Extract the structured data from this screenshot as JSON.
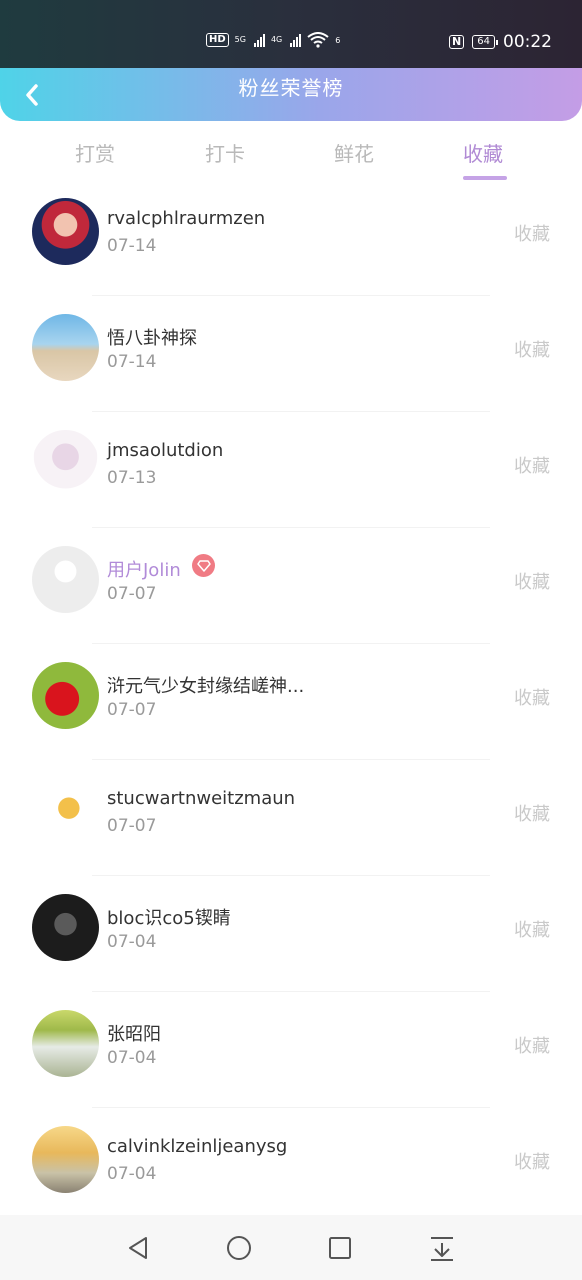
{
  "status": {
    "time": "00:22",
    "battery": "64",
    "hd_label": "HD",
    "net1": "5G",
    "net2": "4G",
    "wifi_label": "6"
  },
  "header": {
    "title": "粉丝荣誉榜"
  },
  "tabs": [
    {
      "label": "打赏",
      "active": false
    },
    {
      "label": "打卡",
      "active": false
    },
    {
      "label": "鲜花",
      "active": false
    },
    {
      "label": "收藏",
      "active": true
    }
  ],
  "rows": [
    {
      "name": "rvalcphlraurmzen",
      "date": "07-14",
      "action": "收藏"
    },
    {
      "name": "悟八卦神探",
      "date": "07-14",
      "action": "收藏"
    },
    {
      "name": "jmsaolutdion",
      "date": "07-13",
      "action": "收藏"
    },
    {
      "name": "用户Jolin",
      "date": "07-07",
      "action": "收藏",
      "vip": true
    },
    {
      "name": "浒元气少女封缘结嵯神...",
      "date": "07-07",
      "action": "收藏"
    },
    {
      "name": "stucwartnweitzmaun",
      "date": "07-07",
      "action": "收藏"
    },
    {
      "name": "bloc识co5锲睛",
      "date": "07-04",
      "action": "收藏"
    },
    {
      "name": "张昭阳",
      "date": "07-04",
      "action": "收藏"
    },
    {
      "name": "calvinklzeinljeanysg",
      "date": "07-04",
      "action": "收藏"
    }
  ],
  "navbar": {
    "icons": [
      "back-triangle-icon",
      "home-circle-icon",
      "recents-square-icon",
      "notification-pull-icon"
    ]
  },
  "colors": {
    "accent": "#b08ad4",
    "header_start": "#4fd3e8",
    "header_end": "#c49de6"
  }
}
